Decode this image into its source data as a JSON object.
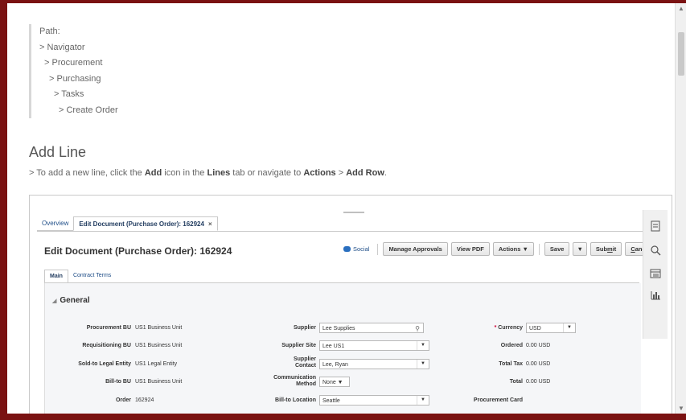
{
  "path": {
    "lines": [
      "Path:",
      "> Navigator",
      "> Procurement",
      "> Purchasing",
      "> Tasks",
      "> Create Order"
    ]
  },
  "section": {
    "title": "Add Line",
    "instruction": {
      "p1": "> To add a new line, click the ",
      "b1": "Add",
      "p2": " icon in the ",
      "b2": "Lines",
      "p3": " tab or navigate to ",
      "b3": "Actions",
      "p4": " > ",
      "b4": "Add Row",
      "p5": "."
    }
  },
  "screenshot": {
    "tabs": {
      "overview": "Overview",
      "edit_doc": "Edit Document (Purchase Order): 162924",
      "close": "×"
    },
    "title": "Edit Document (Purchase Order): 162924",
    "toolbar": {
      "social": "Social",
      "manage_approvals": "Manage Approvals",
      "view_pdf": "View PDF",
      "actions": "Actions ▼",
      "save": "Save",
      "save_dd": "▼",
      "submit_pre": "Sub",
      "submit_u": "m",
      "submit_post": "it",
      "cancel_u": "C",
      "cancel_post": "ancel"
    },
    "subtabs": {
      "main": "Main",
      "contract_terms": "Contract Terms"
    },
    "general": "General",
    "fields": {
      "procurement_bu_label": "Procurement BU",
      "procurement_bu_value": "US1 Business Unit",
      "requisitioning_bu_label": "Requisitioning BU",
      "requisitioning_bu_value": "US1 Business Unit",
      "sold_to_label": "Sold-to Legal Entity",
      "sold_to_value": "US1 Legal Entity",
      "bill_to_bu_label": "Bill-to BU",
      "bill_to_bu_value": "US1 Business Unit",
      "order_label": "Order",
      "order_value": "162924",
      "supplier_label": "Supplier",
      "supplier_value": "Lee Supplies",
      "supplier_site_label": "Supplier Site",
      "supplier_site_value": "Lee US1",
      "supplier_contact_label1": "Supplier",
      "supplier_contact_label2": "Contact",
      "supplier_contact_value": "Lee, Ryan",
      "comm_method_label1": "Communication",
      "comm_method_label2": "Method",
      "comm_method_value": "None ▼",
      "bill_to_location_label": "Bill-to Location",
      "bill_to_location_value": "Seattle",
      "currency_required": "*",
      "currency_label": "Currency",
      "currency_value": "USD",
      "ordered_label": "Ordered",
      "ordered_value": "0.00 USD",
      "total_tax_label": "Total Tax",
      "total_tax_value": "0.00 USD",
      "total_label": "Total",
      "total_value": "0.00 USD",
      "procurement_card_label": "Procurement Card"
    }
  },
  "colors": {
    "frame_border": "#7a1212",
    "link": "#1f4e88"
  }
}
